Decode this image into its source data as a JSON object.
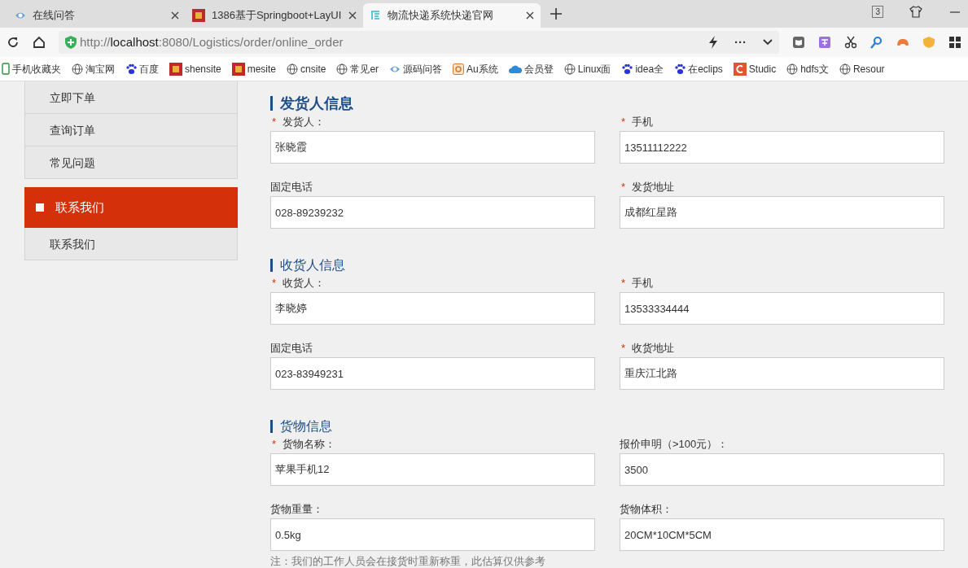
{
  "browser": {
    "tabs": [
      {
        "title": "在线问答",
        "kind": "eye",
        "selected": false
      },
      {
        "title": "1386基于Springboot+LayUI",
        "kind": "red",
        "selected": false
      },
      {
        "title": "物流快递系统快递官网",
        "kind": "glyph",
        "selected": true
      }
    ],
    "tab_count": "3",
    "url_host": "localhost",
    "url_prefix": "http://",
    "url_rest": ":8080/Logistics/order/online_order",
    "more": "···",
    "bookmarks": [
      {
        "label": "手机收藏夹",
        "kind": "phone"
      },
      {
        "label": "淘宝网",
        "kind": "globe"
      },
      {
        "label": "百度",
        "kind": "paw"
      },
      {
        "label": "shensite",
        "kind": "red"
      },
      {
        "label": "mesite",
        "kind": "red"
      },
      {
        "label": "cnsite",
        "kind": "globe"
      },
      {
        "label": "常见er",
        "kind": "globe"
      },
      {
        "label": "源码问答",
        "kind": "eye"
      },
      {
        "label": "Au系统",
        "kind": "au"
      },
      {
        "label": "会员登",
        "kind": "cloud"
      },
      {
        "label": "Linux面",
        "kind": "globe"
      },
      {
        "label": "idea全",
        "kind": "paw"
      },
      {
        "label": "在eclips",
        "kind": "paw"
      },
      {
        "label": "Studic",
        "kind": "studio"
      },
      {
        "label": "hdfs文",
        "kind": "globe"
      },
      {
        "label": "Resour",
        "kind": "globe"
      }
    ]
  },
  "sidebar": [
    {
      "kind": "item",
      "label": "立即下单"
    },
    {
      "kind": "item",
      "label": "查询订单"
    },
    {
      "kind": "item",
      "label": "常见问题"
    },
    {
      "kind": "header",
      "label": "联系我们"
    },
    {
      "kind": "item",
      "label": "联系我们"
    }
  ],
  "sections": [
    {
      "title": "发货人信息",
      "active": true,
      "fields": [
        {
          "mark": "*",
          "label": "发货人：",
          "value": "张晓霞"
        },
        {
          "mark": "*",
          "label": "手机",
          "value": "13511112222"
        },
        {
          "label": "固定电话",
          "value": "028-89239232"
        },
        {
          "mark": "*",
          "label": "发货地址",
          "value": "成都红星路"
        }
      ]
    },
    {
      "title": "收货人信息",
      "active": false,
      "fields": [
        {
          "mark": "*",
          "label": "收货人：",
          "value": "李晓婷"
        },
        {
          "mark": "*",
          "label": "手机",
          "value": "13533334444"
        },
        {
          "label": "固定电话",
          "value": "023-83949231"
        },
        {
          "mark": "*",
          "label": "收货地址",
          "value": "重庆江北路"
        }
      ]
    },
    {
      "title": "货物信息",
      "active": false,
      "fields": [
        {
          "mark": "*",
          "label": "货物名称：",
          "value": "苹果手机12"
        },
        {
          "label": "报价申明（>100元）：",
          "value": "3500"
        },
        {
          "label": "货物重量：",
          "value": "0.5kg"
        },
        {
          "label": "货物体积：",
          "value": "20CM*10CM*5CM"
        }
      ]
    }
  ],
  "note": "注：我们的工作人员会在接货时重新称重，此估算仅供参考"
}
